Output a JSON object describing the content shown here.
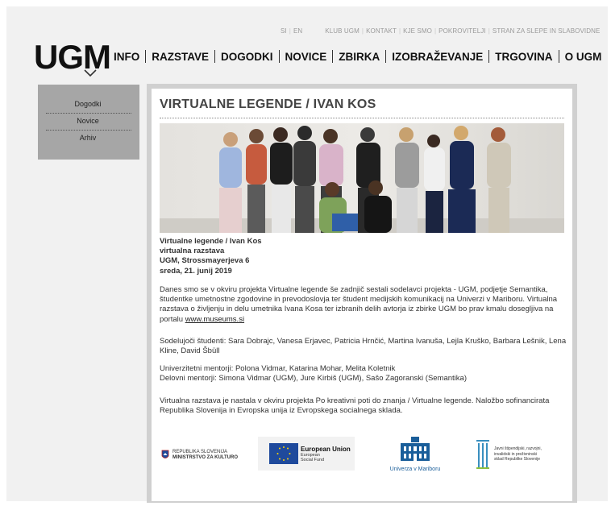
{
  "toplinks": {
    "lang_si": "SI",
    "lang_en": "EN",
    "items": [
      "KLUB UGM",
      "KONTAKT",
      "KJE SMO",
      "POKROVITELJI",
      "STRAN ZA SLEPE IN SLABOVIDNE"
    ]
  },
  "logo": {
    "text": "UGM"
  },
  "mainnav": [
    "INFO",
    "RAZSTAVE",
    "DOGODKI",
    "NOVICE",
    "ZBIRKA",
    "IZOBRAŽEVANJE",
    "TRGOVINA",
    "O UGM"
  ],
  "sidebar": {
    "items": [
      "Dogodki",
      "Novice",
      "Arhiv"
    ]
  },
  "article": {
    "title": "VIRTUALNE LEGENDE / IVAN KOS",
    "info_lines": [
      "Virtualne legende / Ivan Kos",
      "virtualna razstava",
      "UGM, Strossmayerjeva 6",
      "sreda, 21. junij 2019"
    ],
    "para1_text": "Danes smo se v okviru projekta Virtualne legende še zadnjič sestali sodelavci projekta - UGM, podjetje Semantika, študentke umetnostne zgodovine in prevodoslovja ter študent medijskih komunikacij na Univerzi v Mariboru. Virtualna razstava o življenju in delu umetnika Ivana Kosa ter izbranih delih avtorja iz zbirke UGM bo prav kmalu dosegljiva na portalu ",
    "para1_link": "www.museums.si",
    "para2": "Sodelujoči študenti: Sara Dobrajc, Vanesa Erjavec, Patricia Hrnčić, Martina Ivanuša, Lejla Kruško, Barbara Lešnik, Lena Kline, David Šbüll",
    "para3_line1": "Univerzitetni mentorji: Polona Vidmar, Katarina Mohar, Melita Koletnik",
    "para3_line2": "Delovni mentorji: Simona Vidmar (UGM), Jure Kirbiš (UGM), Sašo Zagoranski (Semantika)",
    "para4": "Virtualna razstava je nastala v okviru projekta Po kreativni poti do znanja / Virtualne legende. Naložbo sofinancirata Republika Slovenija in Evropska unija iz Evropskega socialnega sklada."
  },
  "sponsors": {
    "ministry_line1": "REPUBLIKA SLOVENIJA",
    "ministry_line2": "MINISTRSTVO ZA KULTURO",
    "eu_title": "European Union",
    "eu_line1": "European",
    "eu_line2": "Social Fund",
    "um_name": "Univerza v Mariboru",
    "fund_line1": "Javni štipendijski, razvojni,",
    "fund_line2": "invalidski in preživninski",
    "fund_line3": "sklad Republike Slovenije"
  },
  "colors": {
    "eu_blue": "#1f4a9c",
    "um_blue": "#1a5e9a",
    "fund_green": "#8cbf3f"
  }
}
